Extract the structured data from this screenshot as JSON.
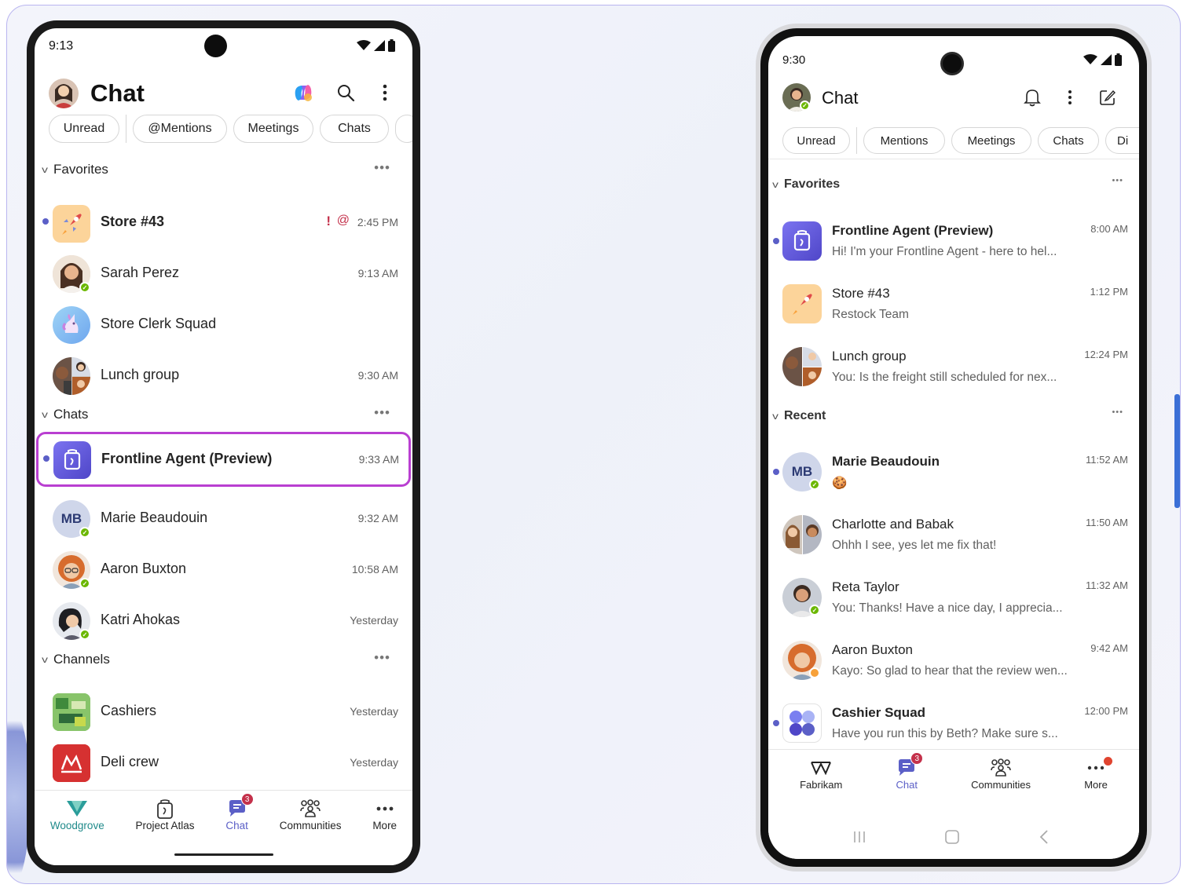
{
  "left_phone": {
    "status_time": "9:13",
    "title": "Chat",
    "filters": [
      "Unread",
      "@Mentions",
      "Meetings",
      "Chats"
    ],
    "sections": {
      "favorites": "Favorites",
      "chats": "Chats",
      "channels": "Channels"
    },
    "favorites": [
      {
        "name": "Store #43",
        "time": "2:45 PM",
        "bold": true,
        "unread": true,
        "important": "!",
        "mention": "@"
      },
      {
        "name": "Sarah Perez",
        "time": "9:13 AM"
      },
      {
        "name": "Store Clerk Squad",
        "time": ""
      },
      {
        "name": "Lunch group",
        "time": "9:30 AM"
      }
    ],
    "chats": [
      {
        "name": "Frontline Agent (Preview)",
        "time": "9:33 AM",
        "bold": true,
        "unread": true,
        "highlighted": true
      },
      {
        "name": "Marie Beaudouin",
        "time": "9:32 AM",
        "initials": "MB"
      },
      {
        "name": "Aaron Buxton",
        "time": "10:58 AM"
      },
      {
        "name": "Katri Ahokas",
        "time": "Yesterday"
      }
    ],
    "channels": [
      {
        "name": "Cashiers",
        "time": "Yesterday"
      },
      {
        "name": "Deli crew",
        "time": "Yesterday"
      }
    ],
    "nav": [
      {
        "label": "Woodgrove",
        "icon": "woodgrove-logo-icon"
      },
      {
        "label": "Project Atlas",
        "icon": "frontline-agent-icon"
      },
      {
        "label": "Chat",
        "icon": "chat-icon",
        "badge": "3",
        "active": true
      },
      {
        "label": "Communities",
        "icon": "communities-icon"
      },
      {
        "label": "More",
        "icon": "more-icon"
      }
    ]
  },
  "right_phone": {
    "status_time": "9:30",
    "title": "Chat",
    "filters": [
      "Unread",
      "Mentions",
      "Meetings",
      "Chats",
      "Di"
    ],
    "sections": {
      "favorites": "Favorites",
      "recent": "Recent"
    },
    "favorites": [
      {
        "name": "Frontline Agent (Preview)",
        "preview": "Hi! I'm your Frontline Agent - here to hel...",
        "time": "8:00 AM",
        "bold": true,
        "unread": true
      },
      {
        "name": "Store #43",
        "preview": "Restock Team",
        "time": "1:12 PM"
      },
      {
        "name": "Lunch group",
        "preview": "You: Is the freight still scheduled for nex...",
        "time": "12:24 PM"
      }
    ],
    "recent": [
      {
        "name": "Marie Beaudouin",
        "preview": "🍪",
        "time": "11:52 AM",
        "bold": true,
        "unread": true,
        "initials": "MB"
      },
      {
        "name": "Charlotte and Babak",
        "preview": "Ohhh I see, yes let me fix that!",
        "time": "11:50 AM"
      },
      {
        "name": "Reta Taylor",
        "preview": "You: Thanks! Have a nice day, I apprecia...",
        "time": "11:32 AM"
      },
      {
        "name": "Aaron Buxton",
        "preview": "Kayo: So glad to hear that the review wen...",
        "time": "9:42 AM"
      },
      {
        "name": "Cashier Squad",
        "preview": "Have you run this by Beth? Make sure s...",
        "time": "12:00 PM",
        "bold": true,
        "unread": true
      }
    ],
    "nav": [
      {
        "label": "Fabrikam",
        "icon": "fabrikam-logo-icon"
      },
      {
        "label": "Chat",
        "icon": "chat-icon",
        "badge": "3",
        "active": true
      },
      {
        "label": "Communities",
        "icon": "communities-icon"
      },
      {
        "label": "More",
        "icon": "more-icon",
        "dot": true
      }
    ]
  },
  "colors": {
    "brand": "#5b5fc7",
    "highlight_border": "#b93fd1",
    "presence_available": "#6bb700",
    "badge": "#c4314b"
  }
}
